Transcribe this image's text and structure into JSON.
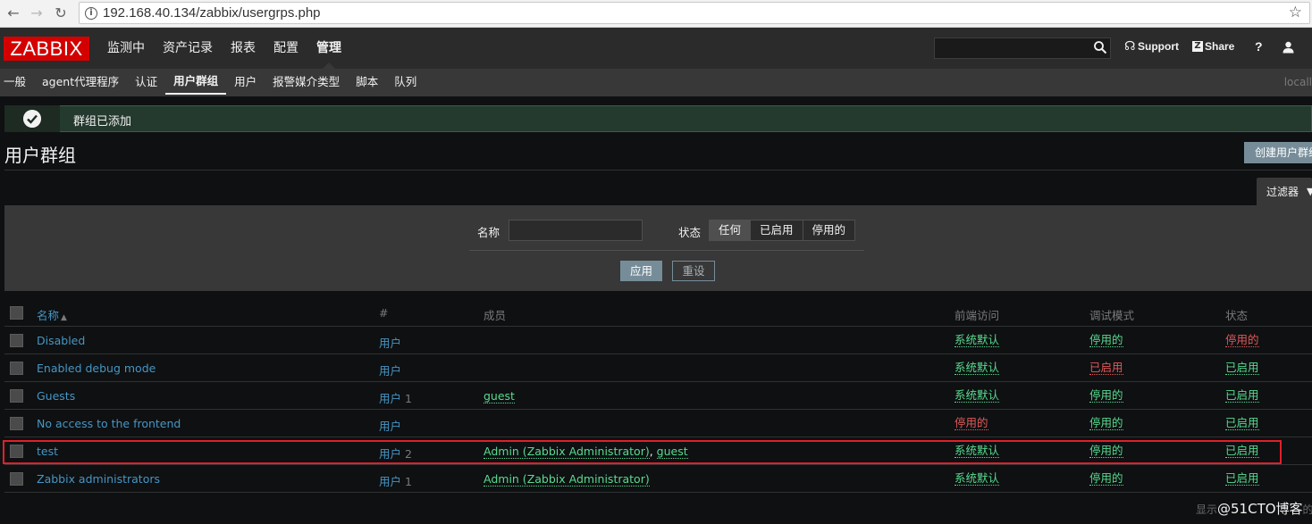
{
  "browser": {
    "url": "192.168.40.134/zabbix/usergrps.php"
  },
  "header": {
    "logo": "ZABBIX",
    "menu": [
      "监测中",
      "资产记录",
      "报表",
      "配置",
      "管理"
    ],
    "active_menu": "管理",
    "support": "Support",
    "share": "Share",
    "help": "?"
  },
  "submenu": {
    "items": [
      "一般",
      "agent代理程序",
      "认证",
      "用户群组",
      "用户",
      "报警媒介类型",
      "脚本",
      "队列"
    ],
    "active": "用户群组",
    "right_text": "locall"
  },
  "message": {
    "text": "群组已添加"
  },
  "page": {
    "title": "用户群组",
    "create_button": "创建用户群组"
  },
  "filter": {
    "tab_label": "过滤器",
    "name_label": "名称",
    "name_value": "",
    "status_label": "状态",
    "status_options": [
      "任何",
      "已启用",
      "停用的"
    ],
    "status_selected": "任何",
    "apply": "应用",
    "reset": "重设"
  },
  "table": {
    "headers": {
      "name": "名称",
      "sort_indicator": "▲",
      "count": "#",
      "members": "成员",
      "frontend": "前端访问",
      "debug": "调试模式",
      "status": "状态"
    },
    "rows": [
      {
        "name": "Disabled",
        "users_label": "用户",
        "count": "",
        "members": [],
        "frontend": "系统默认",
        "frontend_color": "green",
        "debug": "停用的",
        "debug_color": "green",
        "status": "停用的",
        "status_color": "red"
      },
      {
        "name": "Enabled debug mode",
        "users_label": "用户",
        "count": "",
        "members": [],
        "frontend": "系统默认",
        "frontend_color": "green",
        "debug": "已启用",
        "debug_color": "red",
        "status": "已启用",
        "status_color": "green"
      },
      {
        "name": "Guests",
        "users_label": "用户",
        "count": "1",
        "members": [
          "guest"
        ],
        "frontend": "系统默认",
        "frontend_color": "green",
        "debug": "停用的",
        "debug_color": "green",
        "status": "已启用",
        "status_color": "green"
      },
      {
        "name": "No access to the frontend",
        "users_label": "用户",
        "count": "",
        "members": [],
        "frontend": "停用的",
        "frontend_color": "red",
        "debug": "停用的",
        "debug_color": "green",
        "status": "已启用",
        "status_color": "green"
      },
      {
        "name": "test",
        "users_label": "用户",
        "count": "2",
        "members": [
          "Admin (Zabbix Administrator)",
          "guest"
        ],
        "frontend": "系统默认",
        "frontend_color": "green",
        "debug": "停用的",
        "debug_color": "green",
        "status": "已启用",
        "status_color": "green"
      },
      {
        "name": "Zabbix administrators",
        "users_label": "用户",
        "count": "1",
        "members": [
          "Admin (Zabbix Administrator)"
        ],
        "frontend": "系统默认",
        "frontend_color": "green",
        "debug": "停用的",
        "debug_color": "green",
        "status": "已启用",
        "status_color": "green"
      }
    ]
  },
  "watermark": {
    "prefix": "显示",
    "text": "@51CTO博客",
    "suffix": "的"
  },
  "colors": {
    "logo_red": "#d40000",
    "link_blue": "#4796c4",
    "ok_green": "#59db8f",
    "error_red": "#e45959",
    "highlight_red": "#e0202a"
  }
}
